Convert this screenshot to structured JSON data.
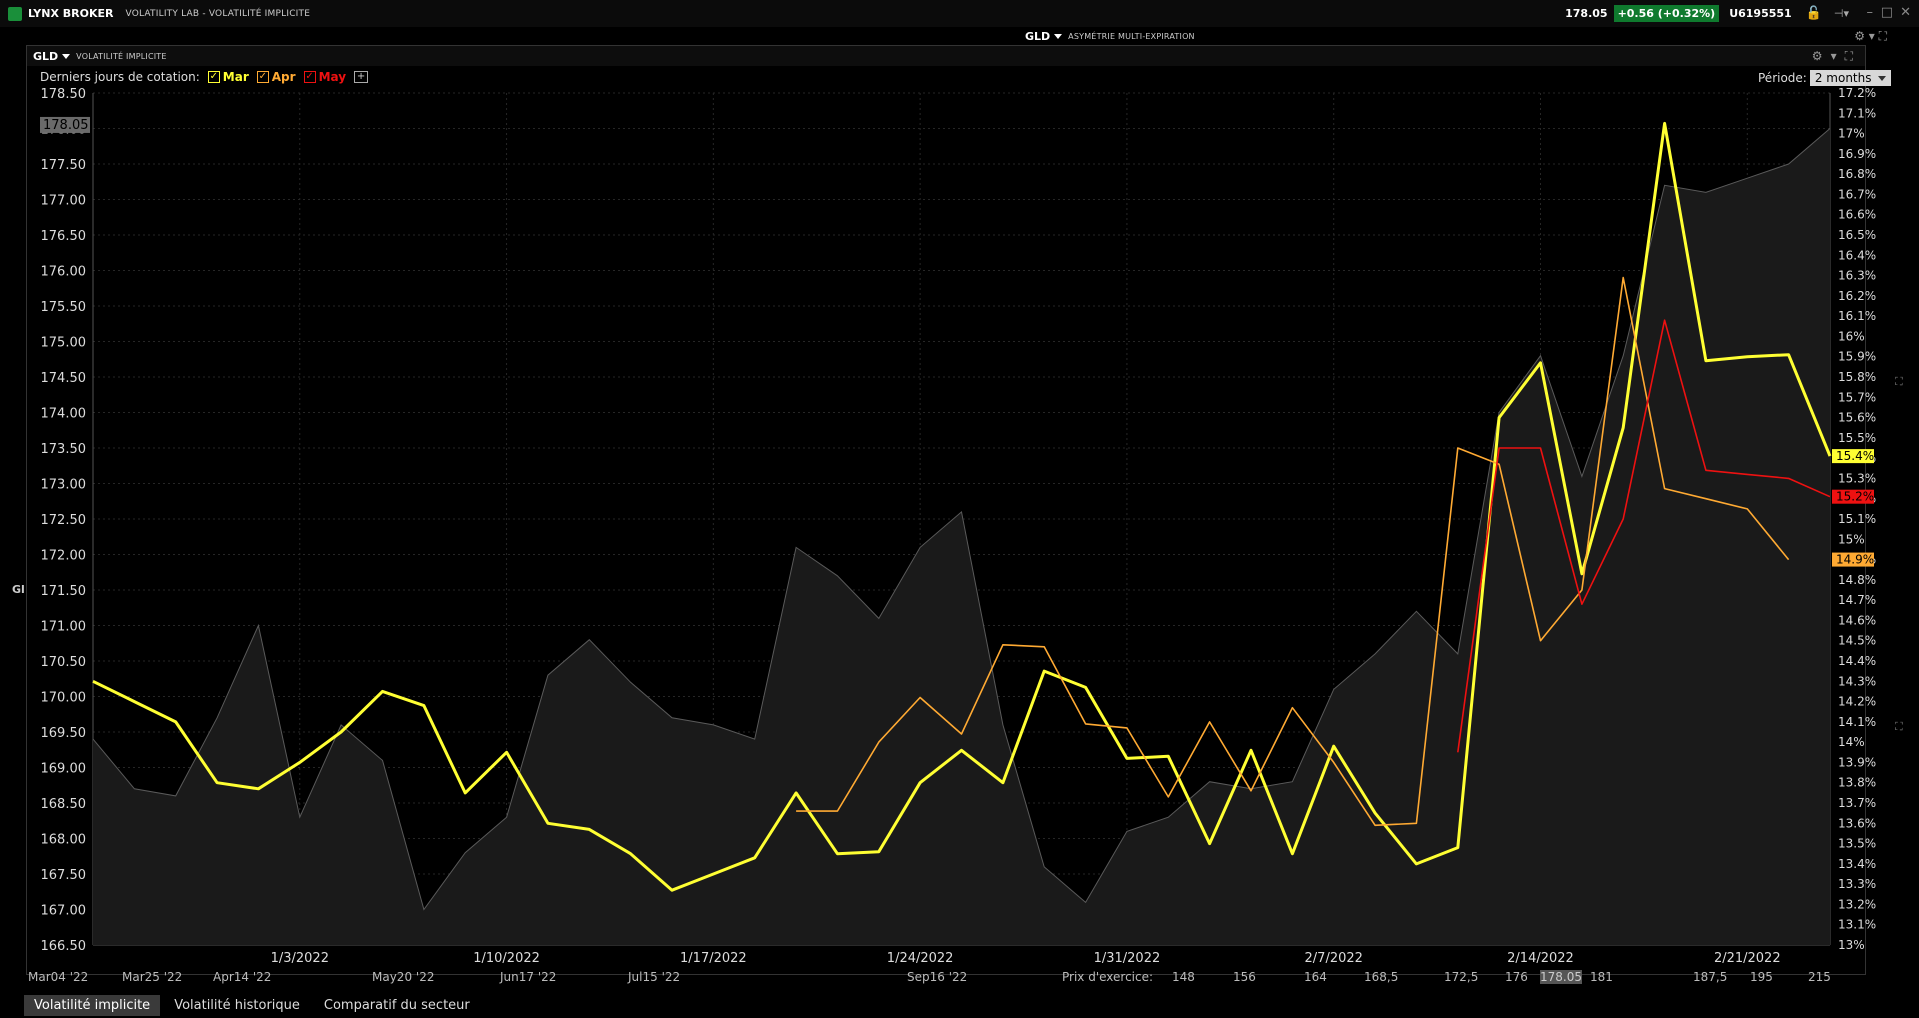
{
  "titlebar": {
    "app_name": "LYNX BROKER",
    "subtitle": "VOLATILITY LAB - VOLATILITÉ IMPLICITE",
    "price": "178.05",
    "change": "+0.56 (+0.32%)",
    "account": "U6195551"
  },
  "background_panel": {
    "symbol": "GLD",
    "title": "ASYMÉTRIE MULTI-EXPIRATION",
    "axis_labels": [
      "Mar04 '22",
      "Mar25 '22",
      "Apr14 '22",
      "May20 '22",
      "Jun17 '22",
      "Jul15 '22",
      "Sep16 '22",
      "Prix d'exercice:",
      "148",
      "156",
      "164",
      "168,5",
      "172,5",
      "176",
      "178.05",
      "181",
      "187,5",
      "195",
      "215"
    ]
  },
  "panel": {
    "symbol": "GLD",
    "title": "VOLATILITÉ IMPLICITE",
    "options_label": "Derniers jours de cotation:",
    "expiries": [
      {
        "label": "Mar",
        "color": "#ffff33",
        "checked": true
      },
      {
        "label": "Apr",
        "color": "#ffaa33",
        "checked": true
      },
      {
        "label": "May",
        "color": "#ee1111",
        "checked": true
      }
    ],
    "period_label": "Période:",
    "period_value": "2 months",
    "current_price_label": "178.05"
  },
  "chart_data": {
    "type": "line",
    "x_tick_labels": [
      "1/3/2022",
      "1/10/2022",
      "1/17/2022",
      "1/24/2022",
      "1/31/2022",
      "2/7/2022",
      "2/14/2022",
      "2/21/2022"
    ],
    "left_axis": {
      "ticks": [
        "178.50",
        "178.00",
        "177.50",
        "177.00",
        "176.50",
        "176.00",
        "175.50",
        "175.00",
        "174.50",
        "174.00",
        "173.50",
        "173.00",
        "172.50",
        "172.00",
        "171.50",
        "171.00",
        "170.50",
        "170.00",
        "169.50",
        "169.00",
        "168.50",
        "168.00",
        "167.50",
        "167.00",
        "166.50"
      ],
      "range": [
        166.5,
        178.5
      ]
    },
    "right_axis": {
      "ticks": [
        "17.2%",
        "17.1%",
        "17%",
        "16.9%",
        "16.8%",
        "16.7%",
        "16.6%",
        "16.5%",
        "16.4%",
        "16.3%",
        "16.2%",
        "16.1%",
        "16%",
        "15.9%",
        "15.8%",
        "15.7%",
        "15.6%",
        "15.5%",
        "15.4%",
        "15.3%",
        "15.2%",
        "15.1%",
        "15%",
        "14.9%",
        "14.8%",
        "14.7%",
        "14.6%",
        "14.5%",
        "14.4%",
        "14.3%",
        "14.2%",
        "14.1%",
        "14%",
        "13.9%",
        "13.8%",
        "13.7%",
        "13.6%",
        "13.5%",
        "13.4%",
        "13.3%",
        "13.2%",
        "13.1%",
        "13%"
      ],
      "range": [
        13.0,
        17.2
      ]
    },
    "price_series": {
      "name": "GLD",
      "values": [
        169.4,
        168.7,
        168.6,
        169.7,
        171.0,
        168.3,
        169.6,
        169.1,
        167.0,
        167.8,
        168.3,
        170.3,
        170.8,
        170.2,
        169.7,
        169.6,
        169.4,
        172.1,
        171.7,
        171.1,
        172.1,
        172.6,
        169.6,
        167.6,
        167.1,
        168.1,
        168.3,
        168.8,
        168.7,
        168.8,
        170.1,
        170.6,
        171.2,
        170.6,
        174.0,
        174.8,
        173.1,
        174.8,
        177.2,
        177.1,
        177.3,
        177.5,
        178.0
      ]
    },
    "series": [
      {
        "name": "Mar",
        "color": "#ffff33",
        "last_label": "15.4%",
        "values": [
          14.3,
          14.2,
          14.1,
          13.8,
          13.77,
          13.9,
          14.05,
          14.25,
          14.18,
          13.75,
          13.95,
          13.6,
          13.57,
          13.45,
          13.27,
          13.35,
          13.43,
          13.75,
          13.45,
          13.46,
          13.8,
          13.96,
          13.8,
          14.35,
          14.27,
          13.92,
          13.93,
          13.5,
          13.96,
          13.45,
          13.98,
          13.65,
          13.4,
          13.48,
          15.6,
          15.87,
          14.83,
          15.55,
          17.05,
          15.88,
          15.9,
          15.91,
          15.41
        ]
      },
      {
        "name": "Apr",
        "color": "#ffaa33",
        "last_label": "14.9%",
        "values": [
          null,
          null,
          null,
          null,
          null,
          null,
          null,
          null,
          null,
          null,
          null,
          null,
          null,
          null,
          null,
          null,
          null,
          13.66,
          13.66,
          14.0,
          14.22,
          14.04,
          14.48,
          14.47,
          14.09,
          14.07,
          13.73,
          14.1,
          13.76,
          14.17,
          13.9,
          13.59,
          13.6,
          15.45,
          15.37,
          14.5,
          14.75,
          16.29,
          15.25,
          15.2,
          15.15,
          14.9
        ]
      },
      {
        "name": "May",
        "color": "#ee1111",
        "last_label": "15.2%",
        "values": [
          null,
          null,
          null,
          null,
          null,
          null,
          null,
          null,
          null,
          null,
          null,
          null,
          null,
          null,
          null,
          null,
          null,
          null,
          null,
          null,
          null,
          null,
          null,
          null,
          null,
          null,
          null,
          null,
          null,
          null,
          null,
          null,
          null,
          13.95,
          15.45,
          15.45,
          14.68,
          15.1,
          16.08,
          15.34,
          15.32,
          15.3,
          15.21
        ]
      }
    ]
  },
  "tabs": [
    "Volatilité implicite",
    "Volatilité historique",
    "Comparatif du secteur"
  ]
}
